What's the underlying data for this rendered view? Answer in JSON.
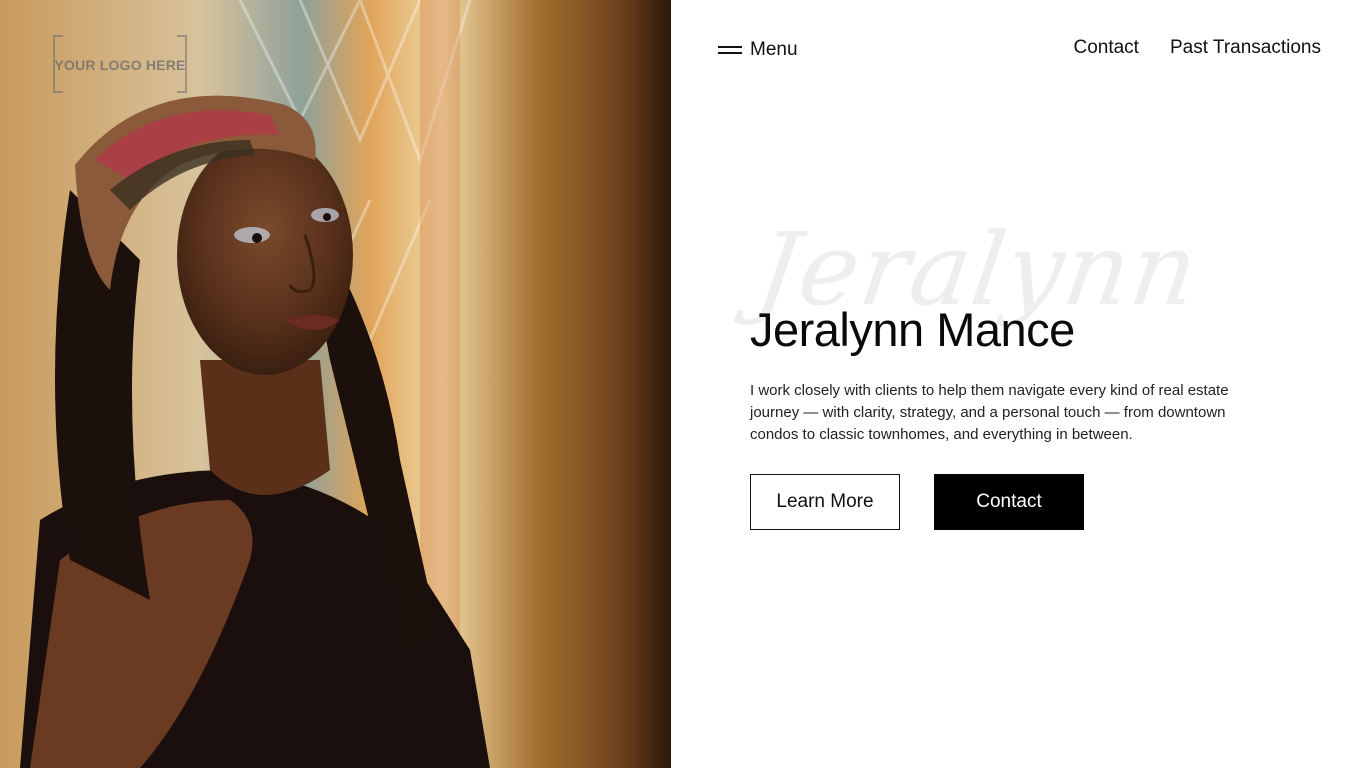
{
  "logo": {
    "text": "YOUR LOGO HERE"
  },
  "nav": {
    "menu_label": "Menu",
    "links": [
      "Contact",
      "Past Transactions"
    ]
  },
  "hero": {
    "script_name": "Jeralynn",
    "name": "Jeralynn Mance",
    "description": "I work closely with clients to help them navigate every kind of real estate journey — with clarity, strategy, and a personal touch — from downtown condos to classic townhomes, and everything in between.",
    "learn_more_label": "Learn More",
    "contact_label": "Contact"
  },
  "colors": {
    "background": "#ffffff",
    "text": "#111111",
    "primary_button": "#000000",
    "script_watermark": "#eeeeee"
  },
  "icons": [
    "hamburger-icon"
  ]
}
